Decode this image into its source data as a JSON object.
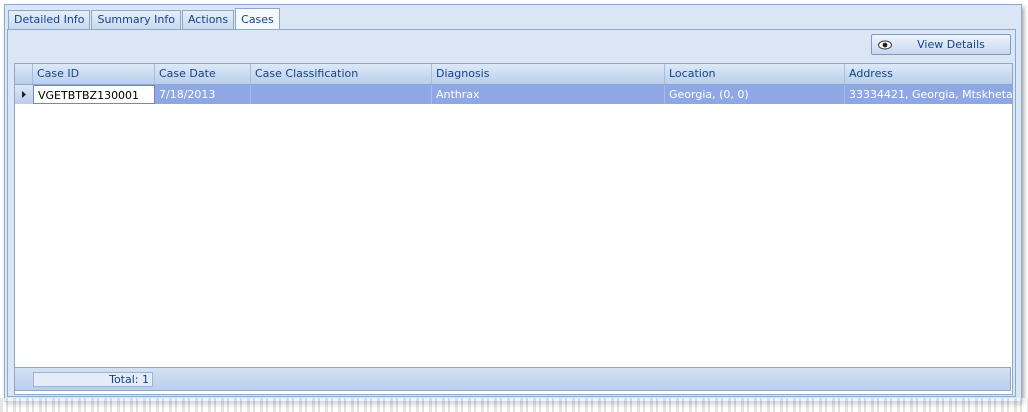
{
  "tabs": [
    {
      "label": "Detailed Info",
      "active": false
    },
    {
      "label": "Summary Info",
      "active": false
    },
    {
      "label": "Actions",
      "active": false
    },
    {
      "label": "Cases",
      "active": true
    }
  ],
  "toolbar": {
    "view_details_label": "View Details",
    "view_details_icon": "eye-icon"
  },
  "grid": {
    "columns": [
      "Case ID",
      "Case Date",
      "Case Classification",
      "Diagnosis",
      "Location",
      "Address"
    ],
    "rows": [
      {
        "case_id": "VGETBTBZ130001",
        "case_date": "7/18/2013",
        "case_classification": "",
        "diagnosis": "Anthrax",
        "location": "Georgia, (0, 0)",
        "address": "33334421, Georgia, Mtskheta-..."
      }
    ],
    "selected_row_color": "#8fa7e4",
    "header_text_color": "#15428b"
  },
  "footer": {
    "total_label": "Total: 1"
  }
}
